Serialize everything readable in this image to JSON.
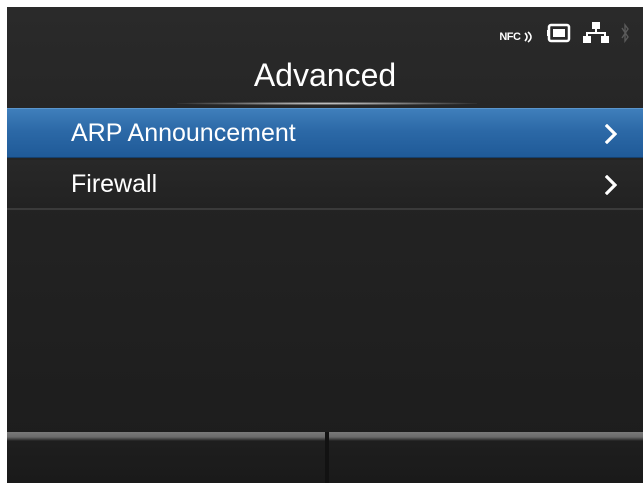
{
  "header": {
    "title": "Advanced",
    "status": {
      "nfc_label": "NFC",
      "icons": [
        "nfc-icon",
        "sd-card-icon",
        "network-icon",
        "bluetooth-icon"
      ]
    }
  },
  "menu": {
    "items": [
      {
        "label": "ARP Announcement",
        "selected": true,
        "icon": "chevron-right-icon"
      },
      {
        "label": "Firewall",
        "selected": false,
        "icon": "chevron-right-icon"
      }
    ]
  },
  "softkeys": {
    "left_label": "",
    "right_label": ""
  },
  "colors": {
    "selection": "#2c69a7",
    "background": "#232323",
    "text": "#ffffff"
  }
}
